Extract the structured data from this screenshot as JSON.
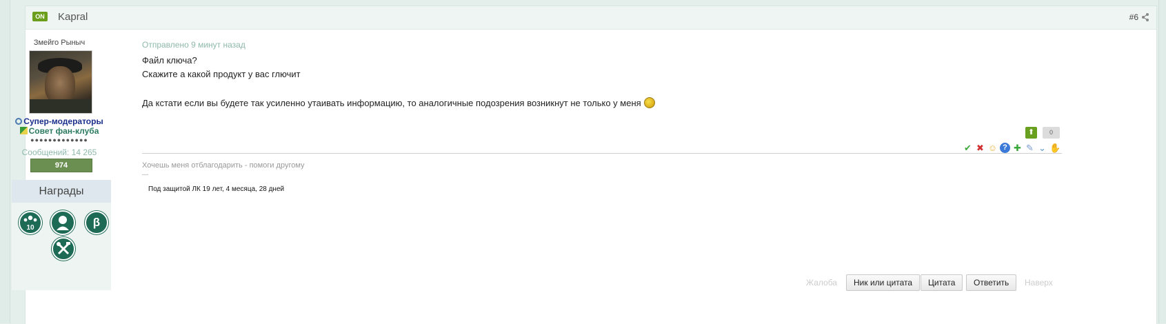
{
  "post": {
    "online_badge": "ON",
    "author": "Kapral",
    "number": "#6"
  },
  "author_panel": {
    "user_title": "Змейго Рыныч",
    "group_1": "Супер-модераторы",
    "group_2": "Совет фан-клуба",
    "rep_dots": "●●●●●●●●●●●●●",
    "post_count": "Сообщений: 14 265",
    "reputation": "974",
    "awards_title": "Награды",
    "awards": [
      {
        "icon": "people-10-icon",
        "glyph": "⚇"
      },
      {
        "icon": "person-bust-icon",
        "glyph": "●"
      },
      {
        "icon": "beta-icon",
        "glyph": "β"
      },
      {
        "icon": "tools-icon",
        "glyph": "✕"
      }
    ]
  },
  "body": {
    "sent_time": "Отправлено 9 минут назад",
    "line1": "Файл ключа?",
    "line2": "Скажите а какой продукт у вас глючит",
    "line3": "Да кстати если вы будете так усиленно утаивать информацию, то аналогичные подозрения возникнут не только у меня"
  },
  "rating": {
    "up_glyph": "⬆",
    "count": "0"
  },
  "reactions": [
    {
      "name": "check-icon",
      "glyph": "✔",
      "color": "#3aa83a"
    },
    {
      "name": "cross-icon",
      "glyph": "✖",
      "color": "#d03030"
    },
    {
      "name": "smile-icon",
      "glyph": "☺",
      "color": "#e8b030"
    },
    {
      "name": "question-icon",
      "glyph": "?",
      "color": "#3a7ad8"
    },
    {
      "name": "plus-icon",
      "glyph": "✚",
      "color": "#3aa83a"
    },
    {
      "name": "speech-icon",
      "glyph": "✎",
      "color": "#7a9ad0"
    },
    {
      "name": "chevron-icon",
      "glyph": "⌄",
      "color": "#5a9ad8"
    },
    {
      "name": "hand-icon",
      "glyph": "✋",
      "color": "#d8a020"
    }
  ],
  "signature": {
    "line": "Хочешь меня отблагодарить - помоги другому",
    "dash": "---",
    "protect": "Под защитой ЛК 19 лет, 4 месяца, 28 дней"
  },
  "actions": {
    "complaint": "Жалоба",
    "nick_or_quote": "Ник или цитата",
    "quote": "Цитата",
    "reply": "Ответить",
    "top": "Наверх"
  }
}
